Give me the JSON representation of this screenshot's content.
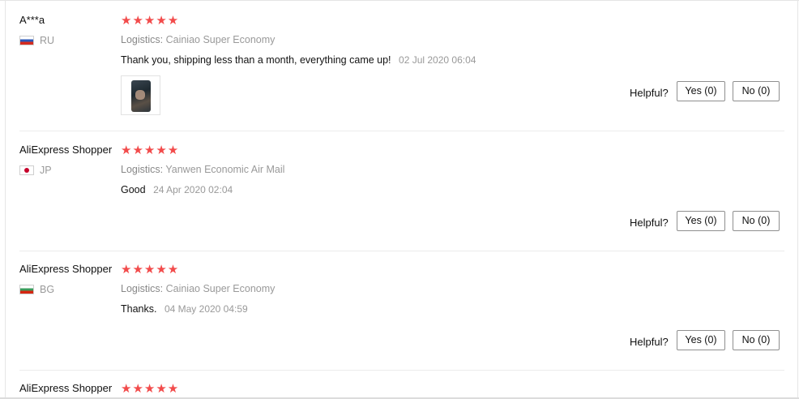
{
  "reviews": [
    {
      "reviewer": "A***a",
      "country": "RU",
      "flag": "ru",
      "rating": "★★★★★",
      "logistics_label": "Logistics:",
      "logistics_value": "Cainiao Super Economy",
      "comment": "Thank you, shipping less than a month, everything came up!",
      "date": "02 Jul 2020 06:04",
      "has_photo": true,
      "helpful_label": "Helpful?",
      "yes_label": "Yes (0)",
      "no_label": "No (0)"
    },
    {
      "reviewer": "AliExpress Shopper",
      "country": "JP",
      "flag": "jp",
      "rating": "★★★★★",
      "logistics_label": "Logistics:",
      "logistics_value": "Yanwen Economic Air Mail",
      "comment": "Good",
      "date": "24 Apr 2020 02:04",
      "has_photo": false,
      "helpful_label": "Helpful?",
      "yes_label": "Yes (0)",
      "no_label": "No (0)"
    },
    {
      "reviewer": "AliExpress Shopper",
      "country": "BG",
      "flag": "bg",
      "rating": "★★★★★",
      "logistics_label": "Logistics:",
      "logistics_value": "Cainiao Super Economy",
      "comment": "Thanks.",
      "date": "04 May 2020 04:59",
      "has_photo": false,
      "helpful_label": "Helpful?",
      "yes_label": "Yes (0)",
      "no_label": "No (0)"
    },
    {
      "reviewer": "AliExpress Shopper",
      "rating": "★★★★★"
    }
  ],
  "colors": {
    "star": "#f24b4b",
    "muted_text": "#999999",
    "separator": "#ececec",
    "button_border": "#8f8f8f"
  }
}
